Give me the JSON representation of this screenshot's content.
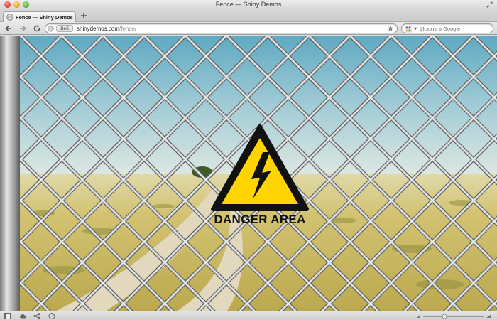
{
  "window": {
    "title": "Fence — Shiny Demos"
  },
  "tabs": [
    {
      "title": "Fence — Shiny Demos",
      "favicon": "globe-icon"
    }
  ],
  "toolbar": {
    "address": {
      "badge": "Веб",
      "host": "shinydemos.com",
      "path": "/fence/"
    },
    "search": {
      "placeholder": "Искать в Google",
      "engine_icon": "google-icon"
    }
  },
  "content": {
    "sign_text": "DANGER AREA",
    "sign_colors": {
      "fill": "#ffd400",
      "border": "#111111"
    }
  },
  "status_bar": {
    "icons": [
      "panel-icon",
      "cloud-icon",
      "share-icon",
      "speed-dial-icon"
    ],
    "zoom_level": 0.35
  }
}
